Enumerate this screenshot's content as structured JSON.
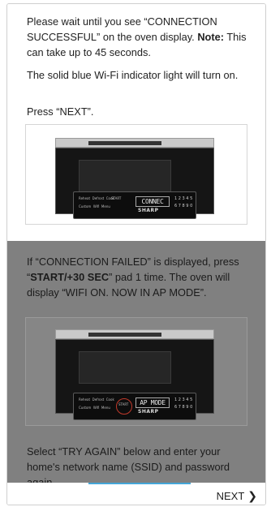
{
  "step": {
    "p1_a": "Please wait until you see “CONNECTION SUCCESSFUL” on the oven display.",
    "p1_note_label": "Note:",
    "p1_b": "This can take up to 45 seconds.",
    "p2": "The solid blue Wi-Fi indicator light will turn on.",
    "p3": "Press “NEXT”.",
    "p4_a": "If “CONNECTION FAILED” is displayed, press “",
    "p4_bold": "START/+30 SEC",
    "p4_b": "” pad 1 time. The oven will display “WIFI ON. NOW IN AP MODE”.",
    "p5": "Select “TRY AGAIN” below and enter your home's network name (SSID) and password again."
  },
  "images": {
    "success_display": "CONNEC",
    "failed_display": "AP MODE",
    "brand": "SHARP"
  },
  "footer": {
    "next_label": "NEXT",
    "next_icon": "chevron-right-icon",
    "progress_percent": 100
  },
  "colors": {
    "progress": "#44a6d8",
    "dim_overlay": "#808080"
  }
}
